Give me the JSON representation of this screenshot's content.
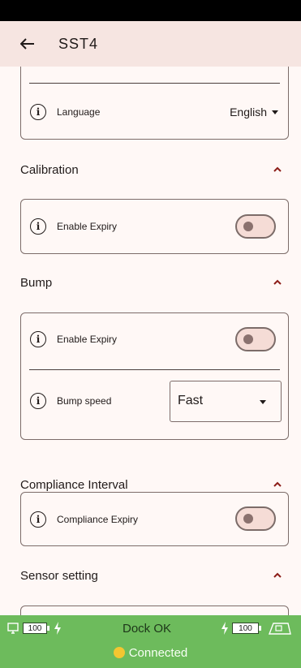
{
  "app_bar": {
    "title": "SST4"
  },
  "general": {
    "language_label": "Language",
    "language_value": "English"
  },
  "calibration": {
    "title": "Calibration",
    "enable_expiry_label": "Enable Expiry",
    "enable_expiry_on": false
  },
  "bump": {
    "title": "Bump",
    "enable_expiry_label": "Enable Expiry",
    "enable_expiry_on": false,
    "bump_speed_label": "Bump speed",
    "bump_speed_value": "Fast"
  },
  "compliance": {
    "title": "Compliance Interval",
    "compliance_expiry_label": "Compliance Expiry",
    "compliance_expiry_on": false
  },
  "sensor": {
    "title": "Sensor setting"
  },
  "footer": {
    "pc_battery": "100",
    "dock_status": "Dock OK",
    "dock_battery": "100",
    "connection_status": "Connected"
  },
  "colors": {
    "app_bar_bg": "#f6e5e1",
    "accent": "#8c1d18",
    "footer_bg": "#6dbb5c",
    "toggle_track": "#f5dcd6"
  }
}
